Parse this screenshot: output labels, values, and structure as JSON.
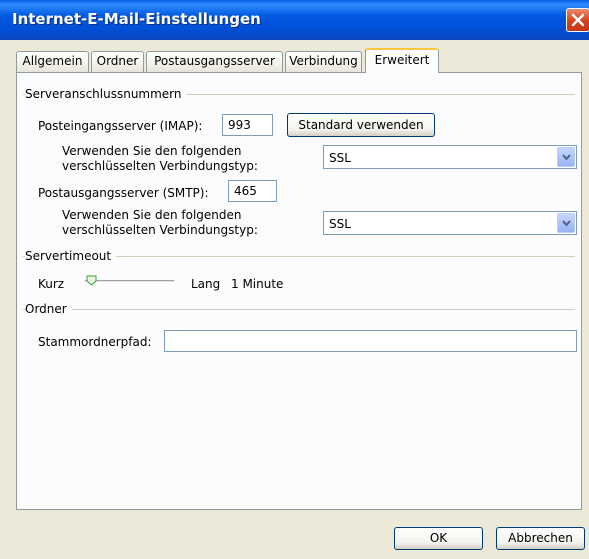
{
  "window": {
    "title": "Internet-E-Mail-Einstellungen"
  },
  "tabs": [
    {
      "label": "Allgemein",
      "active": false
    },
    {
      "label": "Ordner",
      "active": false
    },
    {
      "label": "Postausgangsserver",
      "active": false
    },
    {
      "label": "Verbindung",
      "active": false
    },
    {
      "label": "Erweitert",
      "active": true
    }
  ],
  "server_ports": {
    "group_label": "Serveranschlussnummern",
    "incoming_label": "Posteingangsserver (IMAP):",
    "incoming_value": "993",
    "default_button": "Standard verwenden",
    "incoming_encryption_label_line1": "Verwenden Sie den folgenden",
    "incoming_encryption_label_line2": "verschlüsselten Verbindungstyp:",
    "incoming_encryption_value": "SSL",
    "outgoing_label": "Postausgangsserver (SMTP):",
    "outgoing_value": "465",
    "outgoing_encryption_label_line1": "Verwenden Sie den folgenden",
    "outgoing_encryption_label_line2": "verschlüsselten Verbindungstyp:",
    "outgoing_encryption_value": "SSL"
  },
  "timeout": {
    "group_label": "Servertimeout",
    "short_label": "Kurz",
    "long_label": "Lang",
    "value_text": "1 Minute",
    "slider_fraction": 0.0
  },
  "folders": {
    "group_label": "Ordner",
    "root_path_label": "Stammordnerpfad:",
    "root_path_value": ""
  },
  "footer": {
    "ok_label": "OK",
    "cancel_label": "Abbrechen"
  },
  "colors": {
    "titlebar": "#0054E3",
    "dialog_bg": "#ECE9D8",
    "panel_bg": "#FCFCFE",
    "active_tab_accent": "#FFC83C",
    "close_button": "#D3431E"
  },
  "icons": {
    "close": "close-icon",
    "dropdown": "chevron-down-icon"
  }
}
